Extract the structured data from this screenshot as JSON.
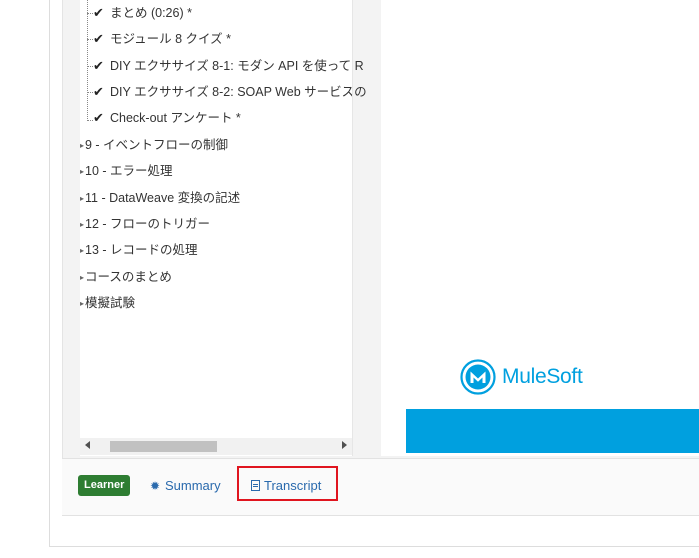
{
  "toc": {
    "lessons": [
      {
        "label": "まとめ (0:26) *"
      },
      {
        "label": "モジュール 8 クイズ *"
      },
      {
        "label": "DIY エクササイズ 8-1: モダン API を使って R"
      },
      {
        "label": "DIY エクササイズ 8-2: SOAP Web サービスの"
      },
      {
        "label": "Check-out アンケート *"
      }
    ],
    "sections": [
      {
        "label": "9 - イベントフローの制御"
      },
      {
        "label": "10 - エラー処理"
      },
      {
        "label": "11 - DataWeave 変換の記述"
      },
      {
        "label": "12 - フローのトリガー"
      },
      {
        "label": "13 - レコードの処理"
      },
      {
        "label": "コースのまとめ"
      },
      {
        "label": "模擬試験"
      }
    ],
    "check_glyph": "✔",
    "collapsed_arrow_glyph": "▸"
  },
  "preview": {
    "logo_text": "MuleSoft",
    "brand_color": "#00a0df"
  },
  "footer": {
    "badge": "Learner",
    "summary_label": "Summary",
    "transcript_label": "Transcript",
    "summary_icon": "gear-icon",
    "transcript_icon": "document-icon",
    "highlight_color": "#e0151f"
  }
}
